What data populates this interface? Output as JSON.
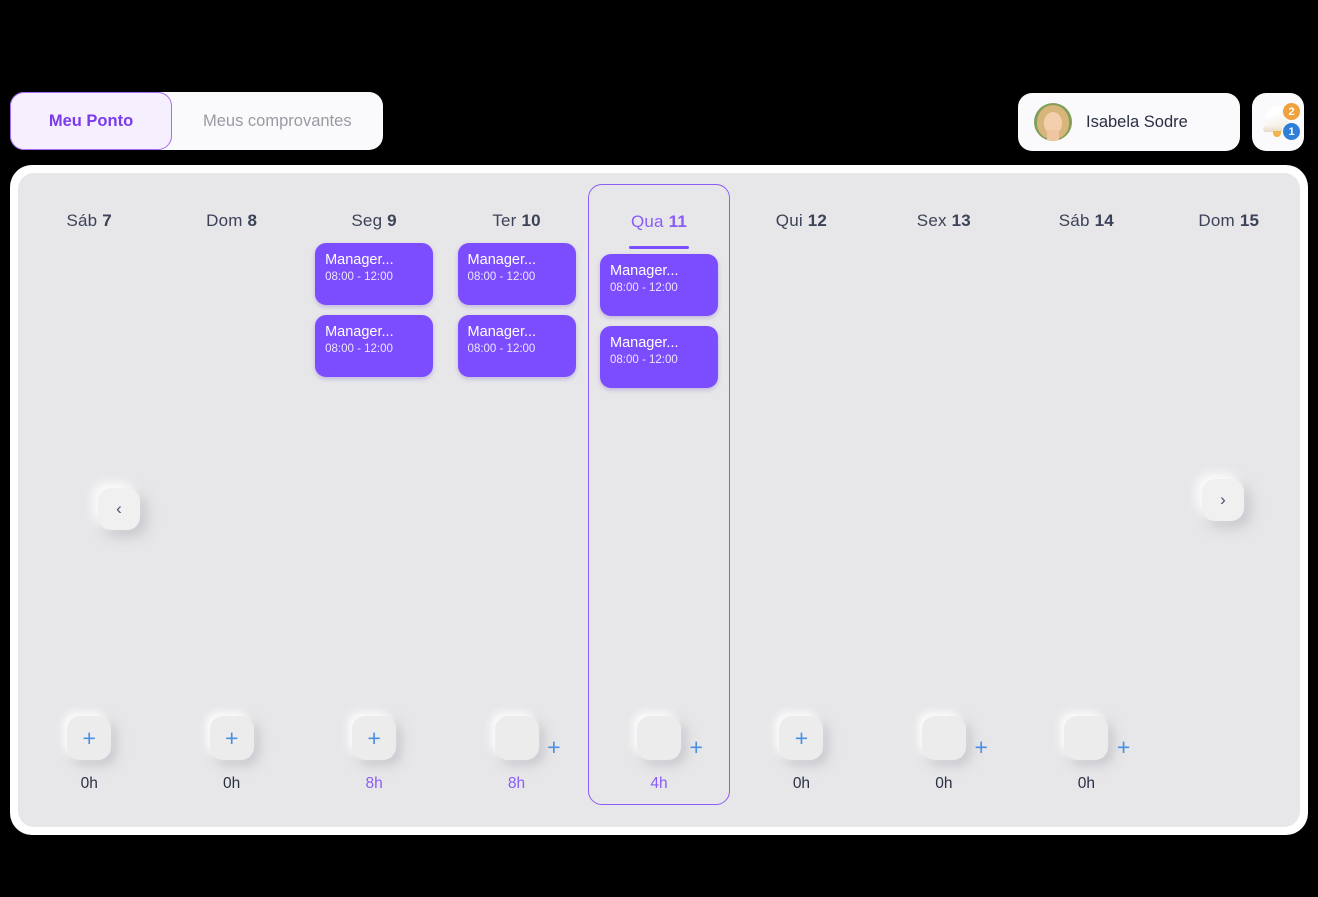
{
  "tabs": [
    {
      "label": "Meu Ponto",
      "active": true
    },
    {
      "label": "Meus comprovantes",
      "active": false
    }
  ],
  "user": {
    "name": "Isabela Sodre",
    "avatar_icon": "user-photo-avatar"
  },
  "notifications": {
    "bell_icon": "bell-icon",
    "badge_primary": "2",
    "badge_secondary": "1",
    "badge_primary_color": "#f0a03c",
    "badge_secondary_color": "#2f7fd8"
  },
  "nav": {
    "prev_icon": "chevron-left-icon",
    "prev_label": "‹",
    "next_icon": "chevron-right-icon",
    "next_label": "›"
  },
  "accent_color": "#7c4dff",
  "plus_color": "#4a90e2",
  "add_label": "+",
  "days": [
    {
      "weekday": "Sáb",
      "num": "7",
      "today": false,
      "events": [],
      "hours": "0h",
      "hours_highlight": false,
      "plus_offset": false
    },
    {
      "weekday": "Dom",
      "num": "8",
      "today": false,
      "events": [],
      "hours": "0h",
      "hours_highlight": false,
      "plus_offset": false
    },
    {
      "weekday": "Seg",
      "num": "9",
      "today": false,
      "events": [
        {
          "title": "Manager...",
          "time": "08:00 - 12:00"
        },
        {
          "title": "Manager...",
          "time": "08:00 - 12:00"
        }
      ],
      "hours": "8h",
      "hours_highlight": true,
      "plus_offset": false
    },
    {
      "weekday": "Ter",
      "num": "10",
      "today": false,
      "events": [
        {
          "title": "Manager...",
          "time": "08:00 - 12:00"
        },
        {
          "title": "Manager...",
          "time": "08:00 - 12:00"
        }
      ],
      "hours": "8h",
      "hours_highlight": true,
      "plus_offset": true
    },
    {
      "weekday": "Qua",
      "num": "11",
      "today": true,
      "events": [
        {
          "title": "Manager...",
          "time": "08:00 - 12:00"
        },
        {
          "title": "Manager...",
          "time": "08:00 - 12:00"
        }
      ],
      "hours": "4h",
      "hours_highlight": true,
      "plus_offset": true
    },
    {
      "weekday": "Qui",
      "num": "12",
      "today": false,
      "events": [],
      "hours": "0h",
      "hours_highlight": false,
      "plus_offset": false
    },
    {
      "weekday": "Sex",
      "num": "13",
      "today": false,
      "events": [],
      "hours": "0h",
      "hours_highlight": false,
      "plus_offset": true
    },
    {
      "weekday": "Sáb",
      "num": "14",
      "today": false,
      "events": [],
      "hours": "0h",
      "hours_highlight": false,
      "plus_offset": true
    },
    {
      "weekday": "Dom",
      "num": "15",
      "today": false,
      "events": [],
      "hours": "",
      "hours_highlight": false,
      "plus_offset": false
    }
  ]
}
